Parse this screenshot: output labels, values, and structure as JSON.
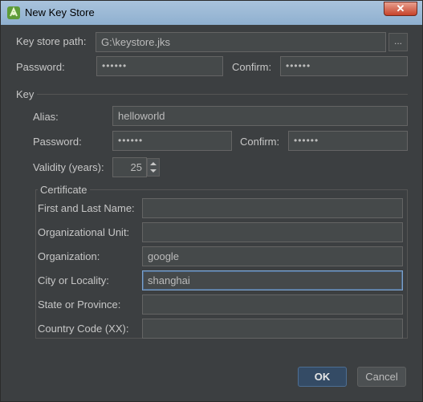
{
  "window": {
    "title": "New Key Store",
    "close_glyph": "✕"
  },
  "keystore": {
    "path_label": "Key store path:",
    "path_value": "G:\\keystore.jks",
    "browse_label": "...",
    "password_label": "Password:",
    "password_value": "••••••",
    "confirm_label": "Confirm:",
    "confirm_value": "••••••"
  },
  "key": {
    "section_label": "Key",
    "alias_label": "Alias:",
    "alias_value": "helloworld",
    "password_label": "Password:",
    "password_value": "••••••",
    "confirm_label": "Confirm:",
    "confirm_value": "••••••",
    "validity_label": "Validity (years):",
    "validity_value": "25"
  },
  "certificate": {
    "group_label": "Certificate",
    "name_label": "First and Last Name:",
    "name_value": "",
    "org_unit_label": "Organizational Unit:",
    "org_unit_value": "",
    "org_label": "Organization:",
    "org_value": "google",
    "city_label": "City or Locality:",
    "city_value": "shanghai",
    "state_label": "State or Province:",
    "state_value": "",
    "country_label": "Country Code (XX):",
    "country_value": ""
  },
  "buttons": {
    "ok_label": "OK",
    "cancel_label": "Cancel"
  },
  "colors": {
    "background": "#3c3f41",
    "field": "#45494a",
    "accent": "#344b65",
    "titlebar": "#a9c3dc"
  },
  "icons": {
    "app": "android-studio-icon",
    "close": "close-icon",
    "spin_up": "chevron-up-icon",
    "spin_down": "chevron-down-icon"
  }
}
